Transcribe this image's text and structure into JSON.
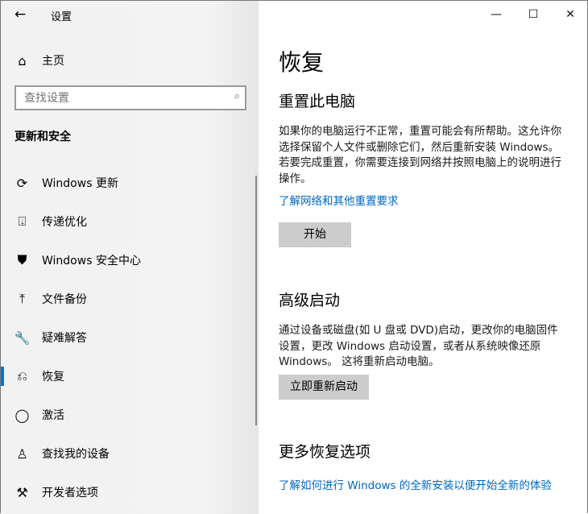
{
  "window": {
    "title": "设置",
    "minimize": "—",
    "maximize": "☐",
    "close": "✕"
  },
  "sidebar": {
    "home": "主页",
    "search_placeholder": "查找设置",
    "section": "更新和安全",
    "items": [
      {
        "label": "Windows 更新",
        "icon": "sync-icon"
      },
      {
        "label": "传递优化",
        "icon": "delivery-icon"
      },
      {
        "label": "Windows 安全中心",
        "icon": "shield-icon"
      },
      {
        "label": "文件备份",
        "icon": "upload-icon"
      },
      {
        "label": "疑难解答",
        "icon": "wrench-icon"
      },
      {
        "label": "恢复",
        "icon": "recovery-icon",
        "selected": true
      },
      {
        "label": "激活",
        "icon": "check-circle-icon"
      },
      {
        "label": "查找我的设备",
        "icon": "find-device-icon"
      },
      {
        "label": "开发者选项",
        "icon": "developer-icon"
      }
    ]
  },
  "main": {
    "title": "恢复",
    "reset": {
      "heading": "重置此电脑",
      "text": "如果你的电脑运行不正常，重置可能会有所帮助。这允许你选择保留个人文件或删除它们，然后重新安装 Windows。若要完成重置，你需要连接到网络并按照电脑上的说明进行操作。",
      "link": "了解网络和其他重置要求",
      "button": "开始"
    },
    "advanced": {
      "heading": "高级启动",
      "text": "通过设备或磁盘(如 U 盘或 DVD)启动，更改你的电脑固件设置，更改 Windows 启动设置，或者从系统映像还原 Windows。 这将重新启动电脑。",
      "button": "立即重新启动"
    },
    "more": {
      "heading": "更多恢复选项",
      "link": "了解如何进行 Windows 的全新安装以便开始全新的体验"
    }
  },
  "colors": {
    "accent": "#0078d7",
    "link": "#0067c0"
  }
}
